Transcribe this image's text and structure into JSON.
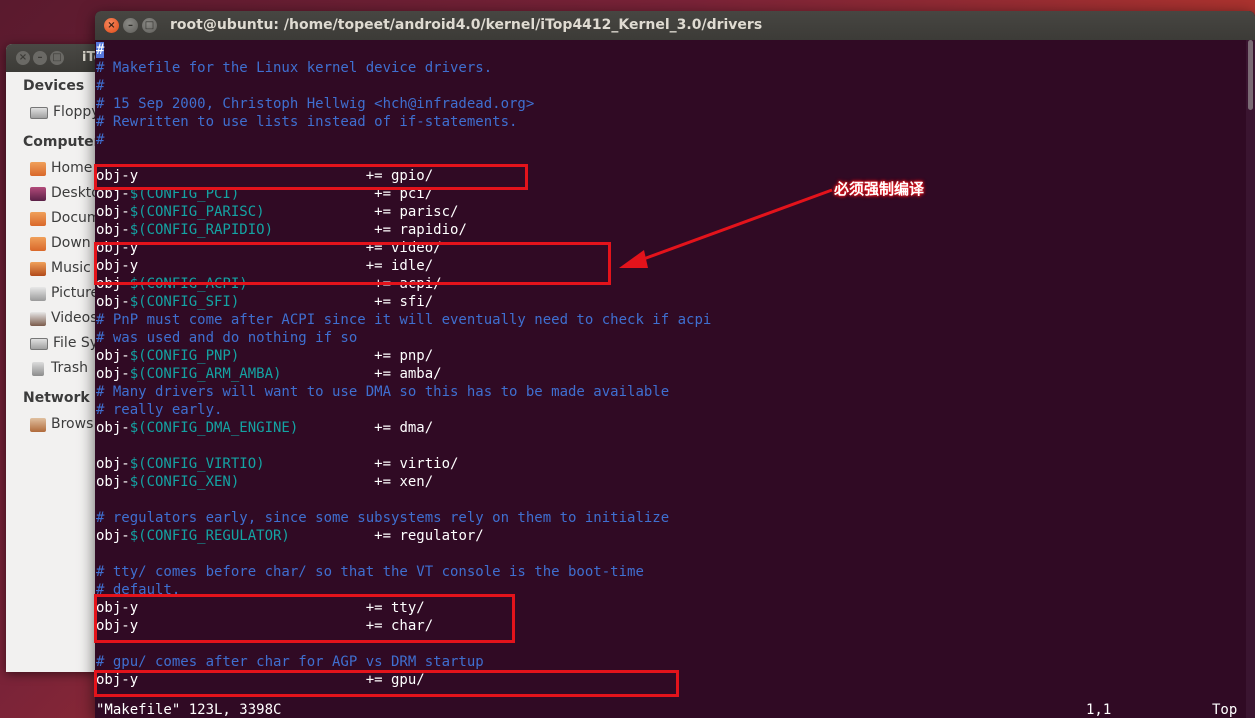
{
  "file_manager": {
    "title": "iTo",
    "sidebar": {
      "devices_heading": "Devices",
      "devices": [
        {
          "label": "Floppy",
          "icon": "floppy-drive-icon"
        }
      ],
      "computer_heading": "Computer",
      "computer": [
        {
          "label": "Home",
          "icon": "home-folder-icon"
        },
        {
          "label": "Deskto",
          "icon": "desktop-folder-icon"
        },
        {
          "label": "Docum",
          "icon": "documents-folder-icon"
        },
        {
          "label": "Down",
          "icon": "downloads-folder-icon"
        },
        {
          "label": "Music",
          "icon": "music-folder-icon"
        },
        {
          "label": "Picture",
          "icon": "pictures-folder-icon"
        },
        {
          "label": "Videos",
          "icon": "videos-folder-icon"
        },
        {
          "label": "File Sy",
          "icon": "filesystem-drive-icon"
        },
        {
          "label": "Trash",
          "icon": "trash-icon"
        }
      ],
      "network_heading": "Network",
      "network": [
        {
          "label": "Brows",
          "icon": "network-browse-icon"
        }
      ]
    }
  },
  "terminal": {
    "title": "root@ubuntu: /home/topeet/android4.0/kernel/iTop4412_Kernel_3.0/drivers",
    "lines": [
      {
        "parts": [
          {
            "t": "#",
            "c": "cursor"
          }
        ]
      },
      {
        "parts": [
          {
            "t": "# Makefile for the Linux kernel device drivers.",
            "c": "cm"
          }
        ]
      },
      {
        "parts": [
          {
            "t": "#",
            "c": "cm"
          }
        ]
      },
      {
        "parts": [
          {
            "t": "# 15 Sep 2000, Christoph Hellwig <hch@infradead.org>",
            "c": "cm"
          }
        ]
      },
      {
        "parts": [
          {
            "t": "# Rewritten to use lists instead of if-statements.",
            "c": "cm"
          }
        ]
      },
      {
        "parts": [
          {
            "t": "#",
            "c": "cm"
          }
        ]
      },
      {
        "parts": []
      },
      {
        "parts": [
          {
            "t": "obj-y                           += gpio/",
            "c": "wh"
          }
        ]
      },
      {
        "parts": [
          {
            "t": "obj-",
            "c": "wh"
          },
          {
            "t": "$(CONFIG_PCI)",
            "c": "vr"
          },
          {
            "t": "                += pci/",
            "c": "wh"
          }
        ]
      },
      {
        "parts": [
          {
            "t": "obj-",
            "c": "wh"
          },
          {
            "t": "$(CONFIG_PARISC)",
            "c": "vr"
          },
          {
            "t": "             += parisc/",
            "c": "wh"
          }
        ]
      },
      {
        "parts": [
          {
            "t": "obj-",
            "c": "wh"
          },
          {
            "t": "$(CONFIG_RAPIDIO)",
            "c": "vr"
          },
          {
            "t": "            += rapidio/",
            "c": "wh"
          }
        ]
      },
      {
        "parts": [
          {
            "t": "obj-y                           += video/",
            "c": "wh"
          }
        ]
      },
      {
        "parts": [
          {
            "t": "obj-y                           += idle/",
            "c": "wh"
          }
        ]
      },
      {
        "parts": [
          {
            "t": "obj-",
            "c": "wh"
          },
          {
            "t": "$(CONFIG_ACPI)",
            "c": "vr"
          },
          {
            "t": "               += acpi/",
            "c": "wh"
          }
        ]
      },
      {
        "parts": [
          {
            "t": "obj-",
            "c": "wh"
          },
          {
            "t": "$(CONFIG_SFI)",
            "c": "vr"
          },
          {
            "t": "                += sfi/",
            "c": "wh"
          }
        ]
      },
      {
        "parts": [
          {
            "t": "# PnP must come after ACPI since it will eventually need to check if acpi",
            "c": "cm"
          }
        ]
      },
      {
        "parts": [
          {
            "t": "# was used and do nothing if so",
            "c": "cm"
          }
        ]
      },
      {
        "parts": [
          {
            "t": "obj-",
            "c": "wh"
          },
          {
            "t": "$(CONFIG_PNP)",
            "c": "vr"
          },
          {
            "t": "                += pnp/",
            "c": "wh"
          }
        ]
      },
      {
        "parts": [
          {
            "t": "obj-",
            "c": "wh"
          },
          {
            "t": "$(CONFIG_ARM_AMBA)",
            "c": "vr"
          },
          {
            "t": "           += amba/",
            "c": "wh"
          }
        ]
      },
      {
        "parts": [
          {
            "t": "# Many drivers will want to use DMA so this has to be made available",
            "c": "cm"
          }
        ]
      },
      {
        "parts": [
          {
            "t": "# really early.",
            "c": "cm"
          }
        ]
      },
      {
        "parts": [
          {
            "t": "obj-",
            "c": "wh"
          },
          {
            "t": "$(CONFIG_DMA_ENGINE)",
            "c": "vr"
          },
          {
            "t": "         += dma/",
            "c": "wh"
          }
        ]
      },
      {
        "parts": []
      },
      {
        "parts": [
          {
            "t": "obj-",
            "c": "wh"
          },
          {
            "t": "$(CONFIG_VIRTIO)",
            "c": "vr"
          },
          {
            "t": "             += virtio/",
            "c": "wh"
          }
        ]
      },
      {
        "parts": [
          {
            "t": "obj-",
            "c": "wh"
          },
          {
            "t": "$(CONFIG_XEN)",
            "c": "vr"
          },
          {
            "t": "                += xen/",
            "c": "wh"
          }
        ]
      },
      {
        "parts": []
      },
      {
        "parts": [
          {
            "t": "# regulators early, since some subsystems rely on them to initialize",
            "c": "cm"
          }
        ]
      },
      {
        "parts": [
          {
            "t": "obj-",
            "c": "wh"
          },
          {
            "t": "$(CONFIG_REGULATOR)",
            "c": "vr"
          },
          {
            "t": "          += regulator/",
            "c": "wh"
          }
        ]
      },
      {
        "parts": []
      },
      {
        "parts": [
          {
            "t": "# tty/ comes before char/ so that the VT console is the boot-time",
            "c": "cm"
          }
        ]
      },
      {
        "parts": [
          {
            "t": "# default.",
            "c": "cm"
          }
        ]
      },
      {
        "parts": [
          {
            "t": "obj-y                           += tty/",
            "c": "wh"
          }
        ]
      },
      {
        "parts": [
          {
            "t": "obj-y                           += char/",
            "c": "wh"
          }
        ]
      },
      {
        "parts": []
      },
      {
        "parts": [
          {
            "t": "# gpu/ comes after char for AGP vs DRM startup",
            "c": "cm"
          }
        ]
      },
      {
        "parts": [
          {
            "t": "obj-y                           += gpu/",
            "c": "wh"
          }
        ]
      }
    ],
    "status": {
      "file_info": "\"Makefile\" 123L, 3398C",
      "position": "1,1",
      "scroll": "Top"
    }
  },
  "annotation": {
    "callout_text": "必须强制编译",
    "highlight_color": "#e3131b"
  },
  "colors": {
    "terminal_bg": "#300a24",
    "comment": "#3f6fd0",
    "variable": "#14a3a3",
    "text": "#ffffff"
  }
}
